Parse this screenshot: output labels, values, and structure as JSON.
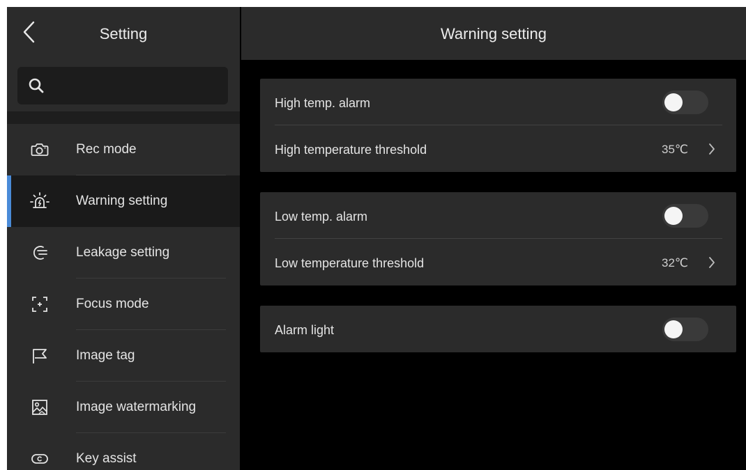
{
  "sidebar": {
    "title": "Setting",
    "back_icon": "back-chevron-icon",
    "search_icon": "search-icon",
    "items": [
      {
        "label": "Rec mode",
        "icon": "camera-icon",
        "active": false
      },
      {
        "label": "Warning setting",
        "icon": "alarm-light-icon",
        "active": true
      },
      {
        "label": "Leakage setting",
        "icon": "leakage-icon",
        "active": false
      },
      {
        "label": "Focus mode",
        "icon": "focus-icon",
        "active": false
      },
      {
        "label": "Image tag",
        "icon": "flag-icon",
        "active": false
      },
      {
        "label": "Image watermarking",
        "icon": "image-watermark-icon",
        "active": false
      },
      {
        "label": "Key assist",
        "icon": "key-assist-icon",
        "active": false
      }
    ]
  },
  "main": {
    "title": "Warning setting",
    "groups": [
      {
        "rows": [
          {
            "label": "High temp. alarm",
            "type": "toggle",
            "on": false
          },
          {
            "label": "High temperature threshold",
            "type": "value",
            "value": "35℃"
          }
        ]
      },
      {
        "rows": [
          {
            "label": "Low temp. alarm",
            "type": "toggle",
            "on": false
          },
          {
            "label": "Low temperature threshold",
            "type": "value",
            "value": "32℃"
          }
        ]
      },
      {
        "rows": [
          {
            "label": "Alarm light",
            "type": "toggle",
            "on": false
          }
        ]
      }
    ]
  },
  "colors": {
    "background": "#000000",
    "panel": "#2b2b2b",
    "active_item": "#1a1a1a",
    "accent": "#4a8bd8",
    "text": "#e4e4e4",
    "toggle_off_track": "#3a3a3a",
    "toggle_knob": "#f5f5f5"
  }
}
